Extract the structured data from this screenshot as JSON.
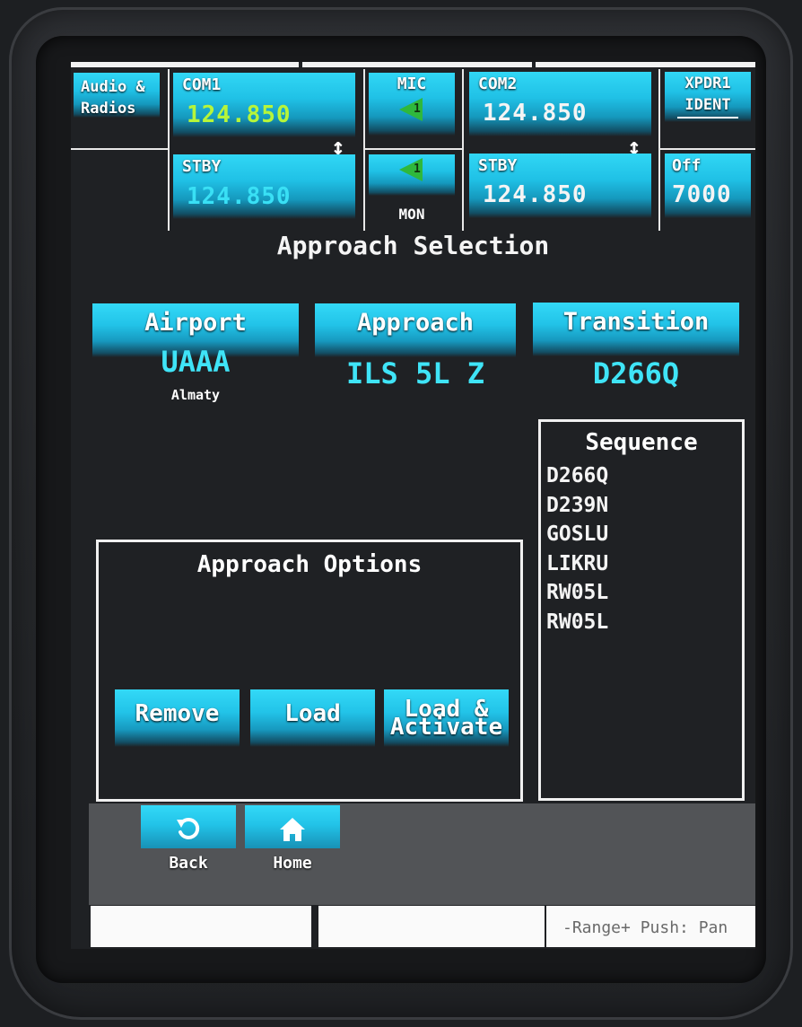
{
  "radios": {
    "audio_label_1": "Audio &",
    "audio_label_2": "Radios",
    "com1": {
      "label": "COM1",
      "active": "124.850",
      "stby_label": "STBY",
      "standby": "124.850"
    },
    "mic_label": "MIC",
    "mon_label": "MON",
    "mic_num": "1",
    "mon_num": "1",
    "com2": {
      "label": "COM2",
      "active": "124.850",
      "stby_label": "STBY",
      "standby": "124.850"
    },
    "xpdr": {
      "label": "XPDR1",
      "ident_label": "IDENT",
      "mode": "Off",
      "code": "7000"
    },
    "swap_glyph": "↕"
  },
  "page_title": "Approach Selection",
  "selection": {
    "airport": {
      "label": "Airport",
      "value": "UAAA",
      "name": "Almaty"
    },
    "approach": {
      "label": "Approach",
      "value": "ILS 5L Z"
    },
    "transition": {
      "label": "Transition",
      "value": "D266Q"
    }
  },
  "sequence": {
    "title": "Sequence",
    "items": [
      "D266Q",
      "D239N",
      "GOSLU",
      "LIKRU",
      "RW05L",
      "RW05L"
    ]
  },
  "options": {
    "title": "Approach Options",
    "remove_label": "Remove",
    "load_label": "Load",
    "load_activate_1": "Load &",
    "load_activate_2": "Activate"
  },
  "nav": {
    "back_label": "Back",
    "home_label": "Home"
  },
  "footer": {
    "range_text": "-Range+ Push: Pan"
  },
  "colors": {
    "accent": "#22c3e8",
    "active_green": "#b6f53a",
    "standby_cyan": "#39e0f5",
    "value_cyan": "#3fe4f7",
    "mic_green": "#2fb83c"
  }
}
